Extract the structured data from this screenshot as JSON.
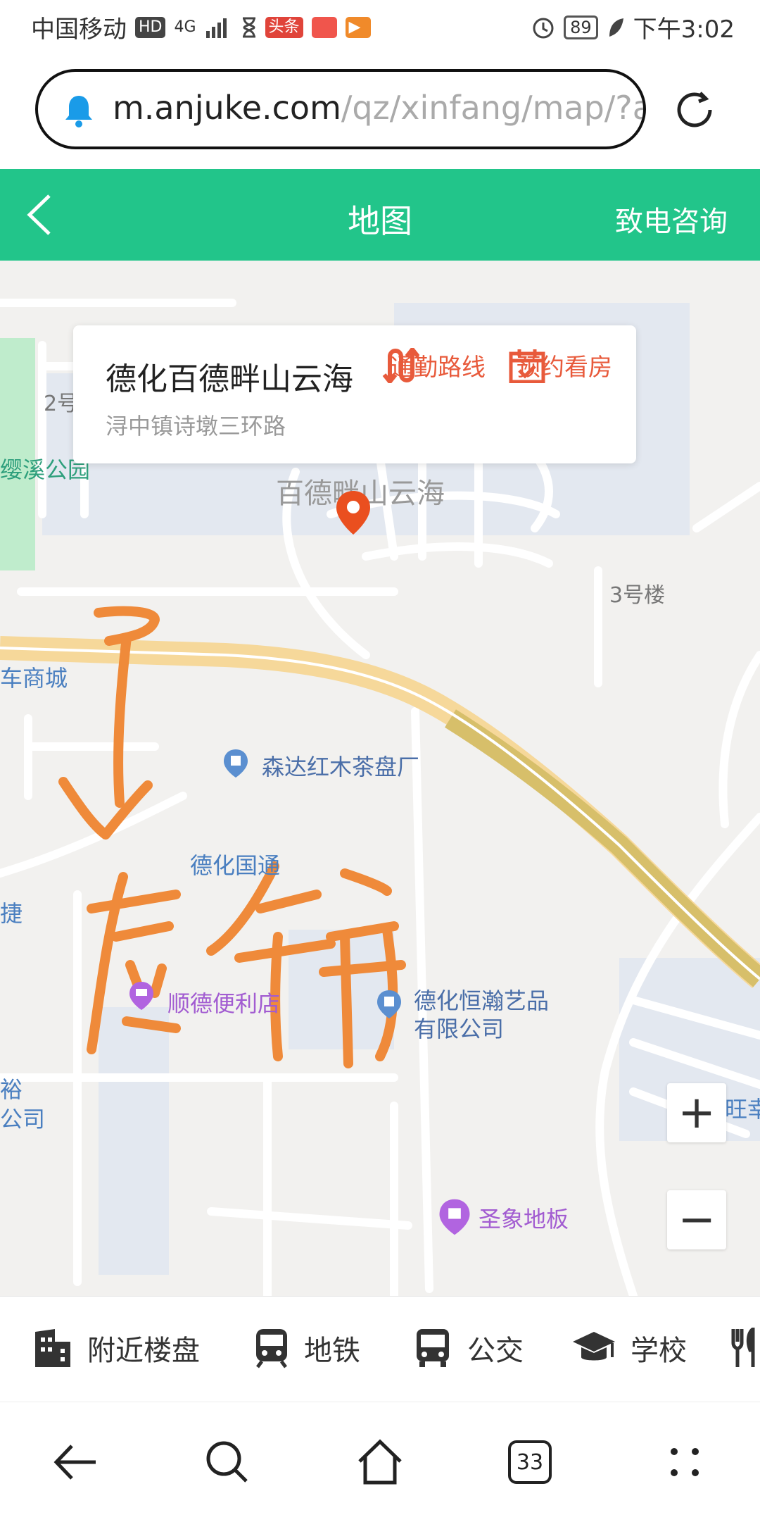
{
  "status_bar": {
    "carrier": "中国移动",
    "hd": "HD",
    "network": "4G",
    "app_badge_1": "头条",
    "battery": "89",
    "time": "下午3:02"
  },
  "browser": {
    "url_host": "m.anjuke.com",
    "url_path": "/qz/xinfang/map/?ac"
  },
  "header": {
    "title": "地图",
    "call_label": "致电咨询"
  },
  "info_card": {
    "name": "德化百德畔山云海",
    "address": "浔中镇诗墩三环路",
    "commute_label": "通勤路线",
    "appointment_label": "预约看房"
  },
  "map_labels": {
    "building_2": "2号",
    "park": "缨溪公园",
    "complex": "百德畔山云海",
    "building_3": "3号楼",
    "car_mall": "车商城",
    "tea_factory": "森达红木茶盘厂",
    "dehua_guotong": "德化国通",
    "jie": "捷",
    "shunde_store": "顺德便利店",
    "hengye_1": "德化恒瀚艺品",
    "hengye_2": "有限公司",
    "left_1": "裕",
    "left_2": "公司",
    "wang": "旺幸",
    "floor_store": "圣象地板"
  },
  "zoom": {
    "in": "+",
    "out": "−"
  },
  "tabs": [
    {
      "label": "附近楼盘",
      "icon": "building-icon"
    },
    {
      "label": "地铁",
      "icon": "subway-icon"
    },
    {
      "label": "公交",
      "icon": "bus-icon"
    },
    {
      "label": "学校",
      "icon": "school-icon"
    },
    {
      "label": "",
      "icon": "restaurant-icon"
    }
  ],
  "nav": {
    "tab_count": "33"
  },
  "colors": {
    "accent_green": "#22c58a",
    "action_red": "#e85a3b",
    "highway": "#f6d89a",
    "annotation": "#ef8a3a"
  }
}
